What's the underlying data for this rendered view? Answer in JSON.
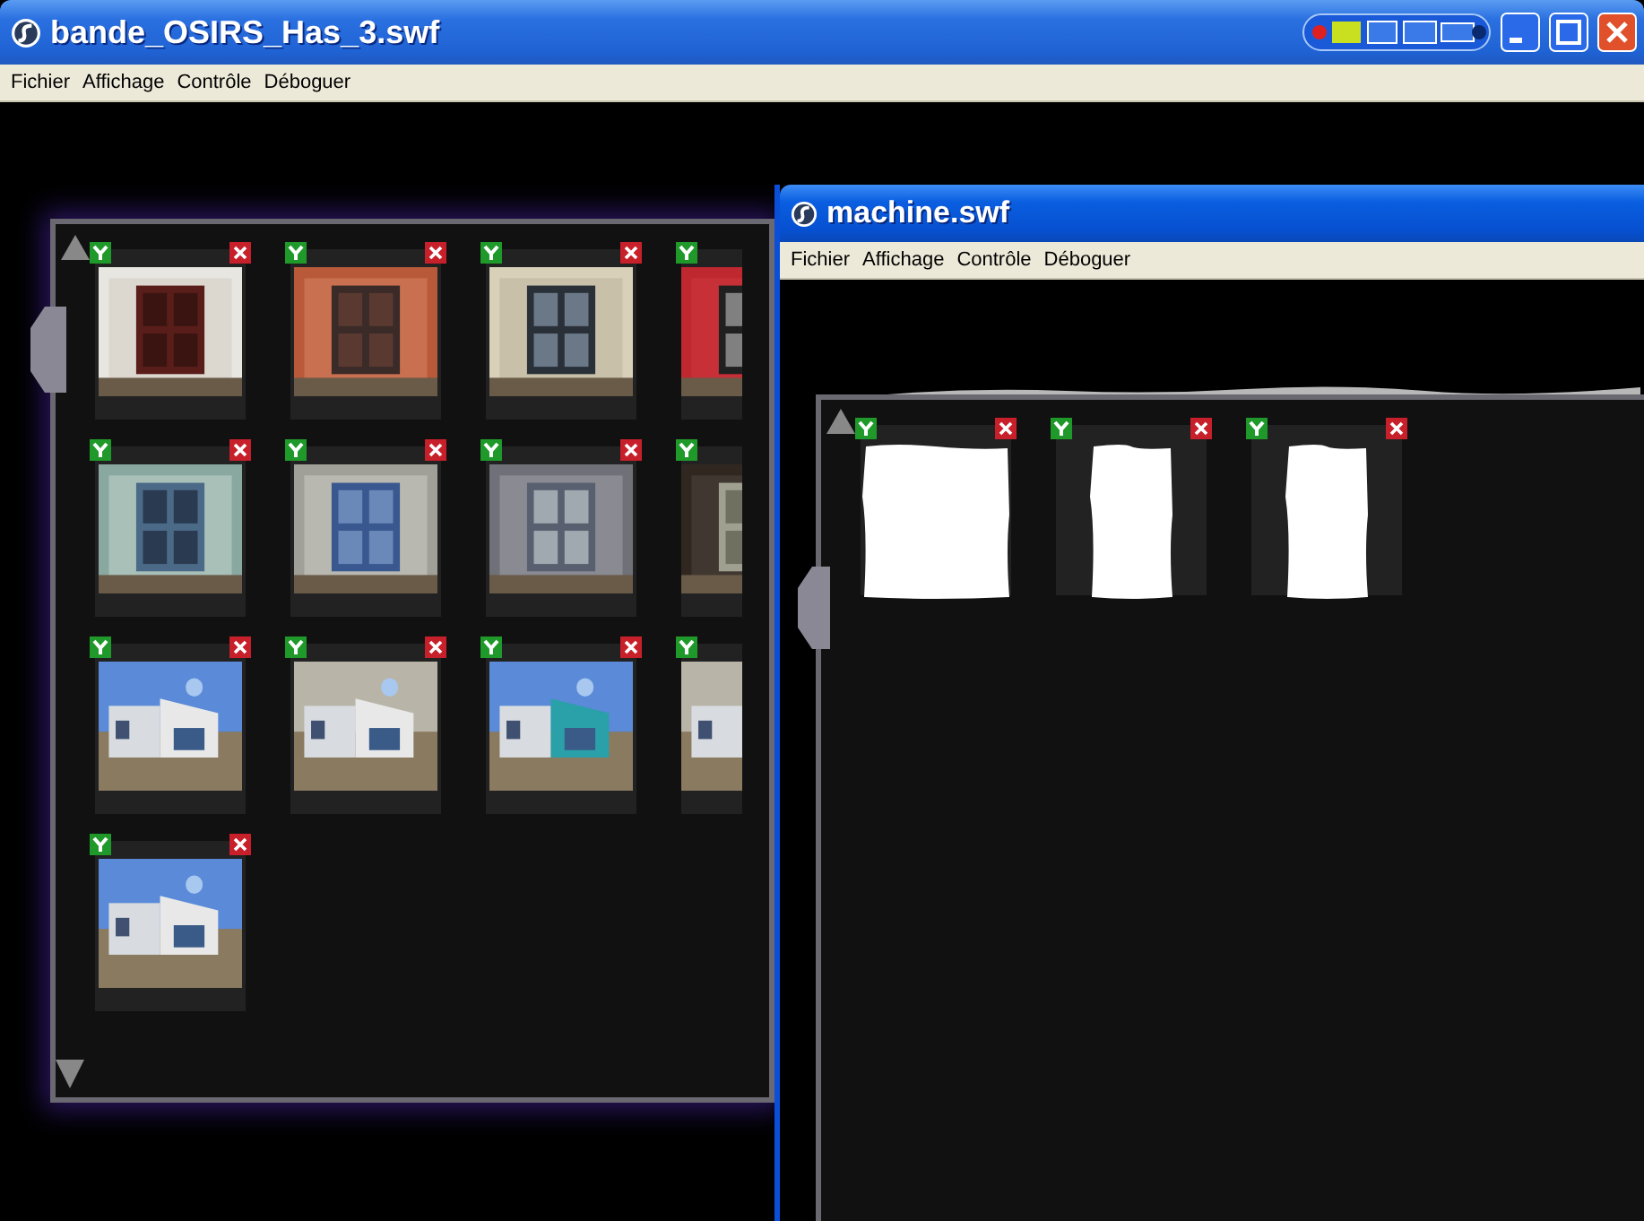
{
  "windows": [
    {
      "title": "bande_OSIRS_Has_3.swf",
      "active": false,
      "menu": [
        "Fichier",
        "Affichage",
        "Contrôle",
        "Déboguer"
      ]
    },
    {
      "title": "machine.swf",
      "active": true,
      "menu": [
        "Fichier",
        "Affichage",
        "Contrôle",
        "Déboguer"
      ],
      "gallery": {
        "tiles": [
          {
            "kind": "blank"
          },
          {
            "kind": "blank"
          },
          {
            "kind": "blank"
          }
        ]
      }
    }
  ]
}
